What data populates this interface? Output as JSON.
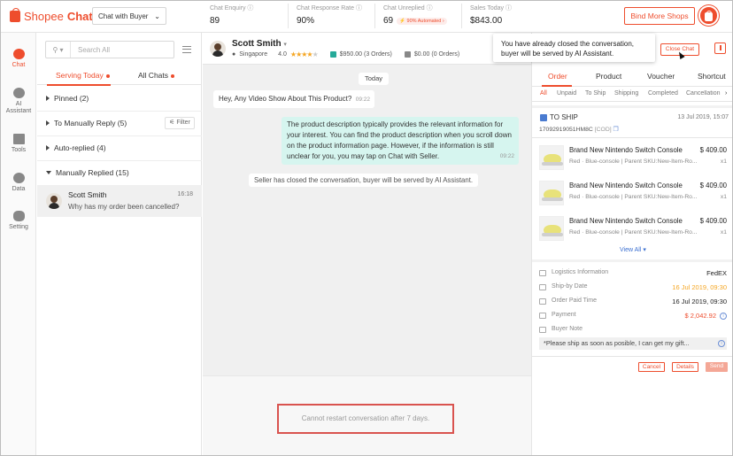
{
  "app": {
    "brand_shop": "Shopee",
    "brand_chat": "Chat",
    "mode_select": "Chat with Buyer"
  },
  "stats": [
    {
      "label": "Chat Enquiry",
      "value": "89"
    },
    {
      "label": "Chat Response Rate",
      "value": "90%"
    },
    {
      "label": "Chat Unreplied",
      "value": "69",
      "badge": "90% Automated"
    },
    {
      "label": "Sales Today",
      "value": "$843.00"
    }
  ],
  "header": {
    "bind_button": "Bind More Shops"
  },
  "nav": [
    {
      "label": "Chat",
      "icon": "chat-icon"
    },
    {
      "label": "AI Assistant",
      "icon": "robot-icon"
    },
    {
      "label": "Tools",
      "icon": "tools-icon"
    },
    {
      "label": "Data",
      "icon": "pie-chart-icon"
    },
    {
      "label": "Setting",
      "icon": "gear-icon"
    }
  ],
  "list": {
    "search_placeholder": "Search All",
    "tabs": [
      "Serving Today",
      "All Chats"
    ],
    "groups": [
      {
        "label": "Pinned (2)"
      },
      {
        "label": "To Manually Reply (5)",
        "action": "Filter"
      },
      {
        "label": "Auto-replied (4)"
      },
      {
        "label": "Manually Replied (15)"
      }
    ],
    "conversation": {
      "name": "Scott Smith",
      "time": "16:18",
      "preview": "Why has my order been cancelled?"
    }
  },
  "chat": {
    "name": "Scott Smith",
    "location": "Singapore",
    "rating": "4.0",
    "spent": "$950.00 (3 Orders)",
    "pending": "$0.00 (0 Orders)",
    "date_divider": "Today",
    "messages": [
      {
        "text": "Hey, Any Video Show About This Product?",
        "time": "09:22"
      },
      {
        "text": "The product description typically provides the relevant information for your interest. You can find the product description when you scroll down on the product information page. However, if the information is still unclear for you, you may tap on Chat with Seller.",
        "time": "09:22"
      }
    ],
    "system": "Seller has closed the conversation, buyer will be served by AI Assistant.",
    "restart_notice": "Cannot restart conversation after 7 days.",
    "tooltip": "You have already closed the conversation, buyer will be served by AI Assistant.",
    "close_button": "Close Chat"
  },
  "panel": {
    "tabs": [
      "Order",
      "Product",
      "Voucher",
      "Shortcut"
    ],
    "subtabs": [
      "All",
      "Unpaid",
      "To Ship",
      "Shipping",
      "Completed",
      "Cancellation"
    ],
    "order": {
      "status": "TO SHIP",
      "date": "13 Jul 2019, 15:07",
      "id": "17092919051HM8C",
      "cod": "[COD]",
      "items": [
        {
          "name": "Brand New Nintendo Switch Console",
          "price": "$ 409.00",
          "variant": "Red · Blue-console | Parent SKU:New-Item-Ro...",
          "qty": "x1"
        },
        {
          "name": "Brand New Nintendo Switch Console",
          "price": "$ 409.00",
          "variant": "Red · Blue-console | Parent SKU:New-Item-Ro...",
          "qty": "x1"
        },
        {
          "name": "Brand New Nintendo Switch Console",
          "price": "$ 409.00",
          "variant": "Red · Blue-console | Parent SKU:New-Item-Ro...",
          "qty": "x1"
        }
      ],
      "view_all": "View All",
      "info": [
        {
          "label": "Logistics Information",
          "value": "FedEX"
        },
        {
          "label": "Ship-by Date",
          "value": "16 Jul 2019,  09:30"
        },
        {
          "label": "Order Paid Time",
          "value": "16 Jul 2019,  09:30"
        },
        {
          "label": "Payment",
          "value": "$ 2,042.92"
        },
        {
          "label": "Buyer Note",
          "value": ""
        }
      ],
      "note": "*Please ship as soon as posible, I can get my gift...",
      "actions": [
        "Cancel",
        "Details",
        "Send"
      ]
    }
  },
  "colors": {
    "accent": "#ee4d2d",
    "ship_by": "#f5a623",
    "payment": "#ee4d2d",
    "my_bubble": "#d6f5ef"
  }
}
